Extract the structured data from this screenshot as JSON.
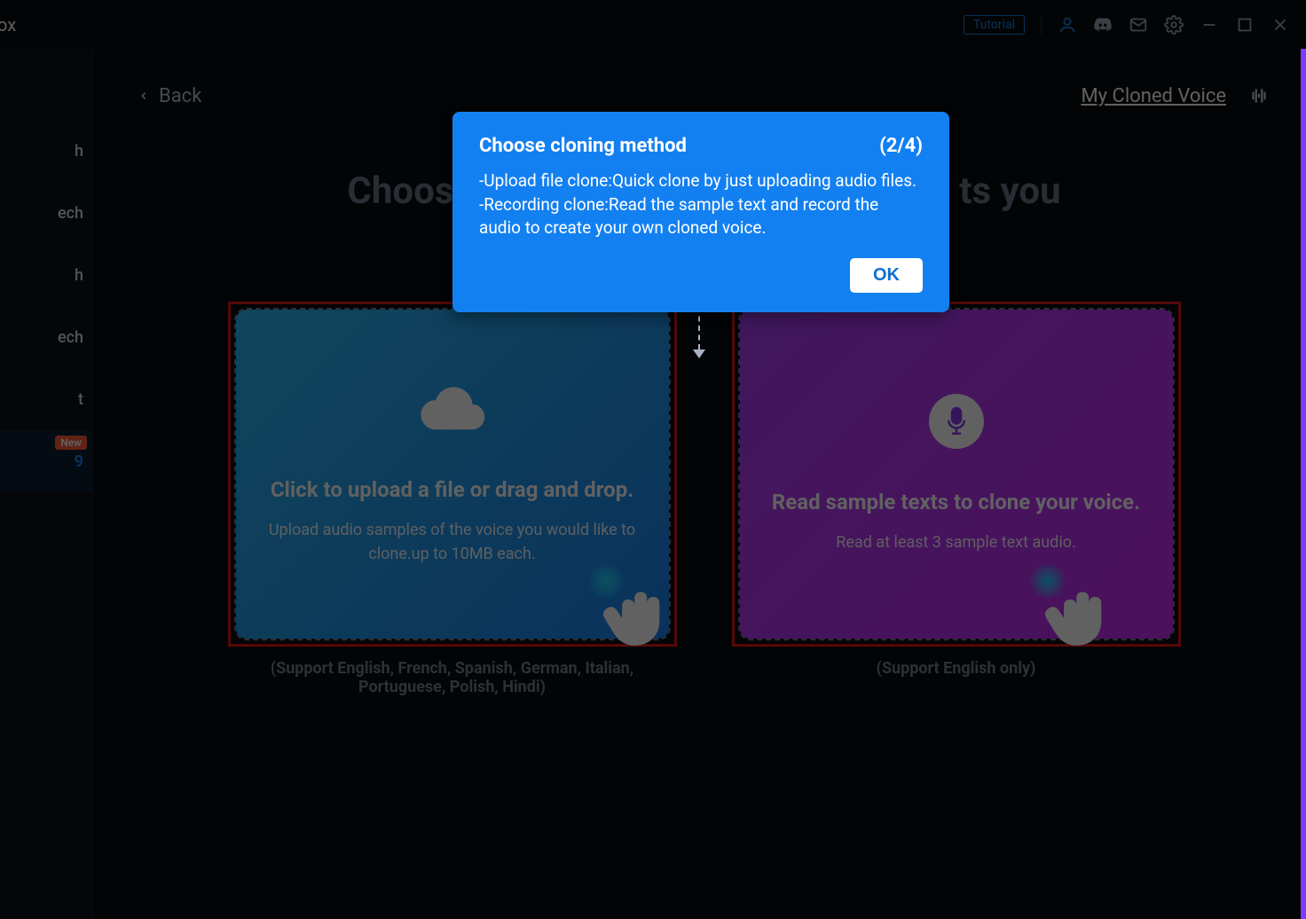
{
  "app": {
    "title_fragment": "tBox"
  },
  "titlebar": {
    "tutorial": "Tutorial"
  },
  "sidebar": {
    "items": [
      {
        "label": "h"
      },
      {
        "label": "ech"
      },
      {
        "label": "h"
      },
      {
        "label": "ech"
      },
      {
        "label": "t"
      },
      {
        "label": "9",
        "active": true,
        "badge": "New"
      }
    ]
  },
  "nav": {
    "back": "Back",
    "my_cloned": "My Cloned Voice"
  },
  "page": {
    "heading_left": "Choos",
    "heading_right": "ts you"
  },
  "tooltip": {
    "title": "Choose cloning method",
    "step": "(2/4)",
    "line1": "-Upload file clone:Quick clone by just uploading audio files.",
    "line2": "-Recording clone:Read the sample text and record the audio to create your own cloned voice.",
    "ok": "OK"
  },
  "upload_card": {
    "title": "Click to upload a file or drag and drop.",
    "sub": "Upload audio samples of the voice you would like to clone.up to 10MB each.",
    "support": "(Support English, French, Spanish, German, Italian, Portuguese, Polish, Hindi)"
  },
  "record_card": {
    "title": "Read sample texts to clone your voice.",
    "sub": "Read at least 3 sample text audio.",
    "support": "(Support English only)"
  }
}
